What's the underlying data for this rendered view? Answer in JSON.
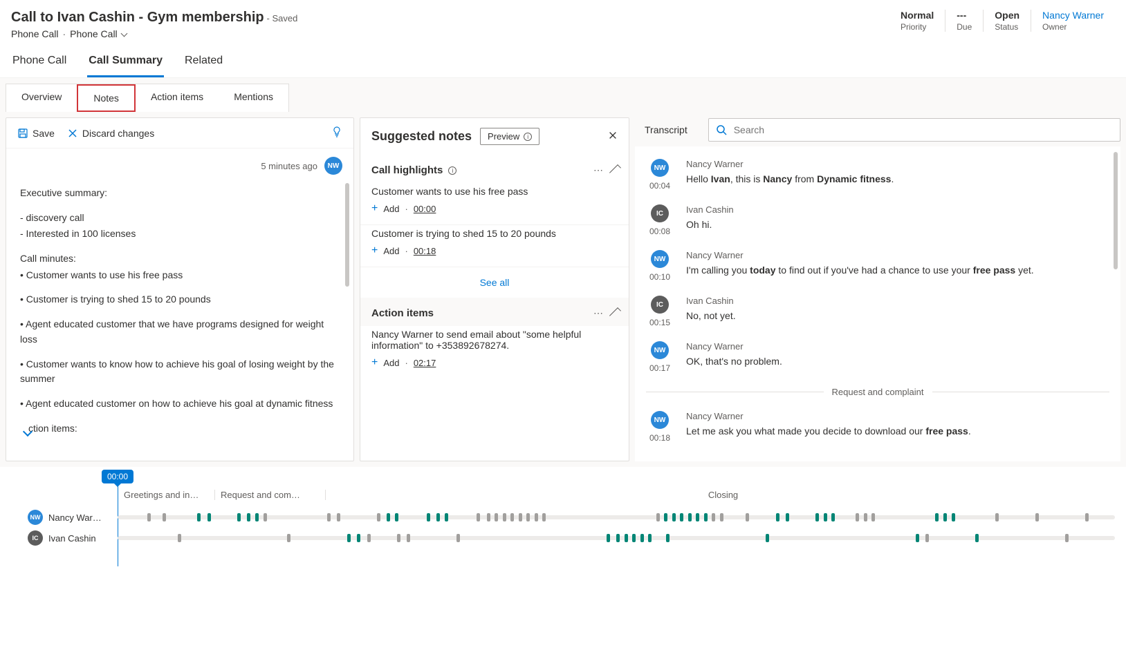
{
  "header": {
    "title": "Call to Ivan Cashin - Gym membership",
    "status": "- Saved",
    "breadcrumb1": "Phone Call",
    "breadcrumb2": "Phone Call"
  },
  "stats": {
    "priority_value": "Normal",
    "priority_label": "Priority",
    "due_value": "---",
    "due_label": "Due",
    "status_value": "Open",
    "status_label": "Status",
    "owner_value": "Nancy Warner",
    "owner_label": "Owner"
  },
  "main_tabs": {
    "phone_call": "Phone Call",
    "call_summary": "Call Summary",
    "related": "Related"
  },
  "sub_tabs": {
    "overview": "Overview",
    "notes": "Notes",
    "action_items": "Action items",
    "mentions": "Mentions"
  },
  "notes_panel": {
    "save": "Save",
    "discard": "Discard changes",
    "meta_time": "5 minutes ago",
    "avatar_initials": "NW",
    "summary_heading": "Executive summary:",
    "summary_line1": "- discovery call",
    "summary_line2": "- Interested in 100 licenses",
    "minutes_heading": "Call minutes:",
    "m1": "• Customer wants to use his free pass",
    "m2": "• Customer is trying to shed 15 to 20 pounds",
    "m3": "• Agent educated customer that we have programs designed for weight loss",
    "m4": "• Customer wants to know how to achieve his goal of losing weight by the summer",
    "m5": "• Agent educated customer on how to achieve his goal at dynamic fitness",
    "m6": "ction items:"
  },
  "sugg": {
    "title": "Suggested notes",
    "preview": "Preview",
    "highlights_title": "Call highlights",
    "h1_text": "Customer wants to use his free pass",
    "h1_ts": "00:00",
    "h2_text": "Customer is trying to shed 15 to 20 pounds",
    "h2_ts": "00:18",
    "add_label": "Add",
    "see_all": "See all",
    "action_title": "Action items",
    "a1_text": "Nancy Warner to send email about \"some helpful information\" to +353892678274.",
    "a1_ts": "02:17"
  },
  "transcript": {
    "title": "Transcript",
    "search_placeholder": "Search",
    "rows": [
      {
        "avatar": "NW",
        "avatar_class": "",
        "speaker": "Nancy Warner",
        "ts": "00:04",
        "html": "Hello <b>Ivan</b>, this is <b>Nancy</b> from <b>Dynamic fitness</b>."
      },
      {
        "avatar": "IC",
        "avatar_class": "dark",
        "speaker": "Ivan Cashin",
        "ts": "00:08",
        "html": "Oh hi."
      },
      {
        "avatar": "NW",
        "avatar_class": "",
        "speaker": "Nancy Warner",
        "ts": "00:10",
        "html": "I'm calling you <b>today</b> to find out if you've had a chance to use your <b>free pass</b> yet."
      },
      {
        "avatar": "IC",
        "avatar_class": "dark",
        "speaker": "Ivan Cashin",
        "ts": "00:15",
        "html": "No, not yet."
      },
      {
        "avatar": "NW",
        "avatar_class": "",
        "speaker": "Nancy Warner",
        "ts": "00:17",
        "html": "OK, that's no problem."
      }
    ],
    "divider": "Request and complaint",
    "rows2": [
      {
        "avatar": "NW",
        "avatar_class": "",
        "speaker": "Nancy Warner",
        "ts": "00:18",
        "html": "Let me ask you what made you decide to download our <b>free pass</b>."
      }
    ]
  },
  "timeline": {
    "marker": "00:00",
    "seg1": "Greetings and in…",
    "seg2": "Request and com…",
    "seg3": "Closing",
    "track1_label": "Nancy War…",
    "track1_avatar": "NW",
    "track2_label": "Ivan Cashin",
    "track2_avatar": "IC"
  }
}
